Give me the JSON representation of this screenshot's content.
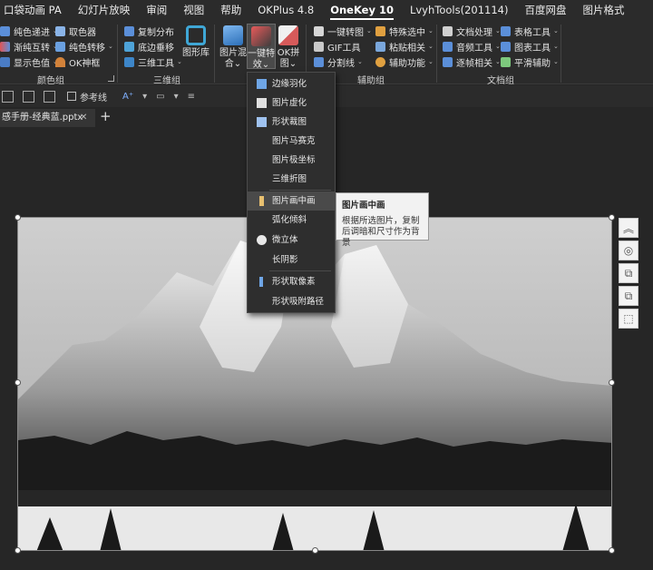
{
  "menubar": {
    "tabs": [
      {
        "label": "口袋动画 PA",
        "active": false
      },
      {
        "label": "幻灯片放映",
        "active": false
      },
      {
        "label": "审阅",
        "active": false
      },
      {
        "label": "视图",
        "active": false
      },
      {
        "label": "帮助",
        "active": false
      },
      {
        "label": "OKPlus 4.8",
        "active": false
      },
      {
        "label": "OneKey 10",
        "active": true
      },
      {
        "label": "LvyhTools(201114)",
        "active": false
      },
      {
        "label": "百度网盘",
        "active": false
      },
      {
        "label": "图片格式",
        "active": false
      }
    ]
  },
  "ribbon": {
    "color_group": {
      "label": "颜色组",
      "buttons": [
        "纯色递进",
        "取色器",
        "渐纯互转",
        "纯色转移",
        "显示色值",
        "OK神框"
      ]
    },
    "three_d_group": {
      "label": "三维组",
      "buttons": [
        "复制分布",
        "底边垂移",
        "三维工具"
      ],
      "big_button": "图形库"
    },
    "image_group": {
      "big_buttons": [
        {
          "label": "图片混合",
          "caret": "⌄"
        },
        {
          "label": "一键特效",
          "caret": "⌄"
        },
        {
          "label": "OK拼图",
          "caret": "⌄"
        }
      ]
    },
    "assist_group": {
      "label": "辅助组",
      "buttons": [
        "一键转图",
        "特殊选中",
        "GIF工具",
        "粘贴相关",
        "分割线",
        "辅助功能"
      ]
    },
    "doc_group": {
      "label": "文档组",
      "buttons": [
        "文档处理",
        "表格工具",
        "音频工具",
        "图表工具",
        "逐帧相关",
        "平滑辅助"
      ]
    }
  },
  "subbar": {
    "ref_line": "参考线"
  },
  "doc_tab": {
    "title": "感手册-经典蓝.pptx",
    "close": "✕",
    "new_tab": "+"
  },
  "dropdown": {
    "items": [
      {
        "label": "边缘羽化",
        "icon": "feather-icon"
      },
      {
        "label": "图片虚化",
        "icon": "blur-icon"
      },
      {
        "label": "形状裁图",
        "icon": "shape-crop-icon"
      },
      {
        "label": "图片马赛克",
        "icon": ""
      },
      {
        "label": "图片极坐标",
        "icon": ""
      },
      {
        "label": "三维折图",
        "icon": ""
      },
      {
        "label": "图片画中画",
        "icon": "pip-icon",
        "hover": true
      },
      {
        "label": "弧化倾斜",
        "icon": ""
      },
      {
        "label": "微立体",
        "icon": "circle-icon"
      },
      {
        "label": "长阴影",
        "icon": ""
      },
      {
        "label": "形状取像素",
        "icon": "pixel-icon"
      },
      {
        "label": "形状吸附路径",
        "icon": ""
      }
    ]
  },
  "tooltip": {
    "title": "图片画中画",
    "body": "根据所选图片，复制后调暗和尺寸作为背景"
  },
  "colors": {
    "background": "#262626",
    "ribbon": "#2b2b2b",
    "menu_hover": "#4a4a4a"
  }
}
